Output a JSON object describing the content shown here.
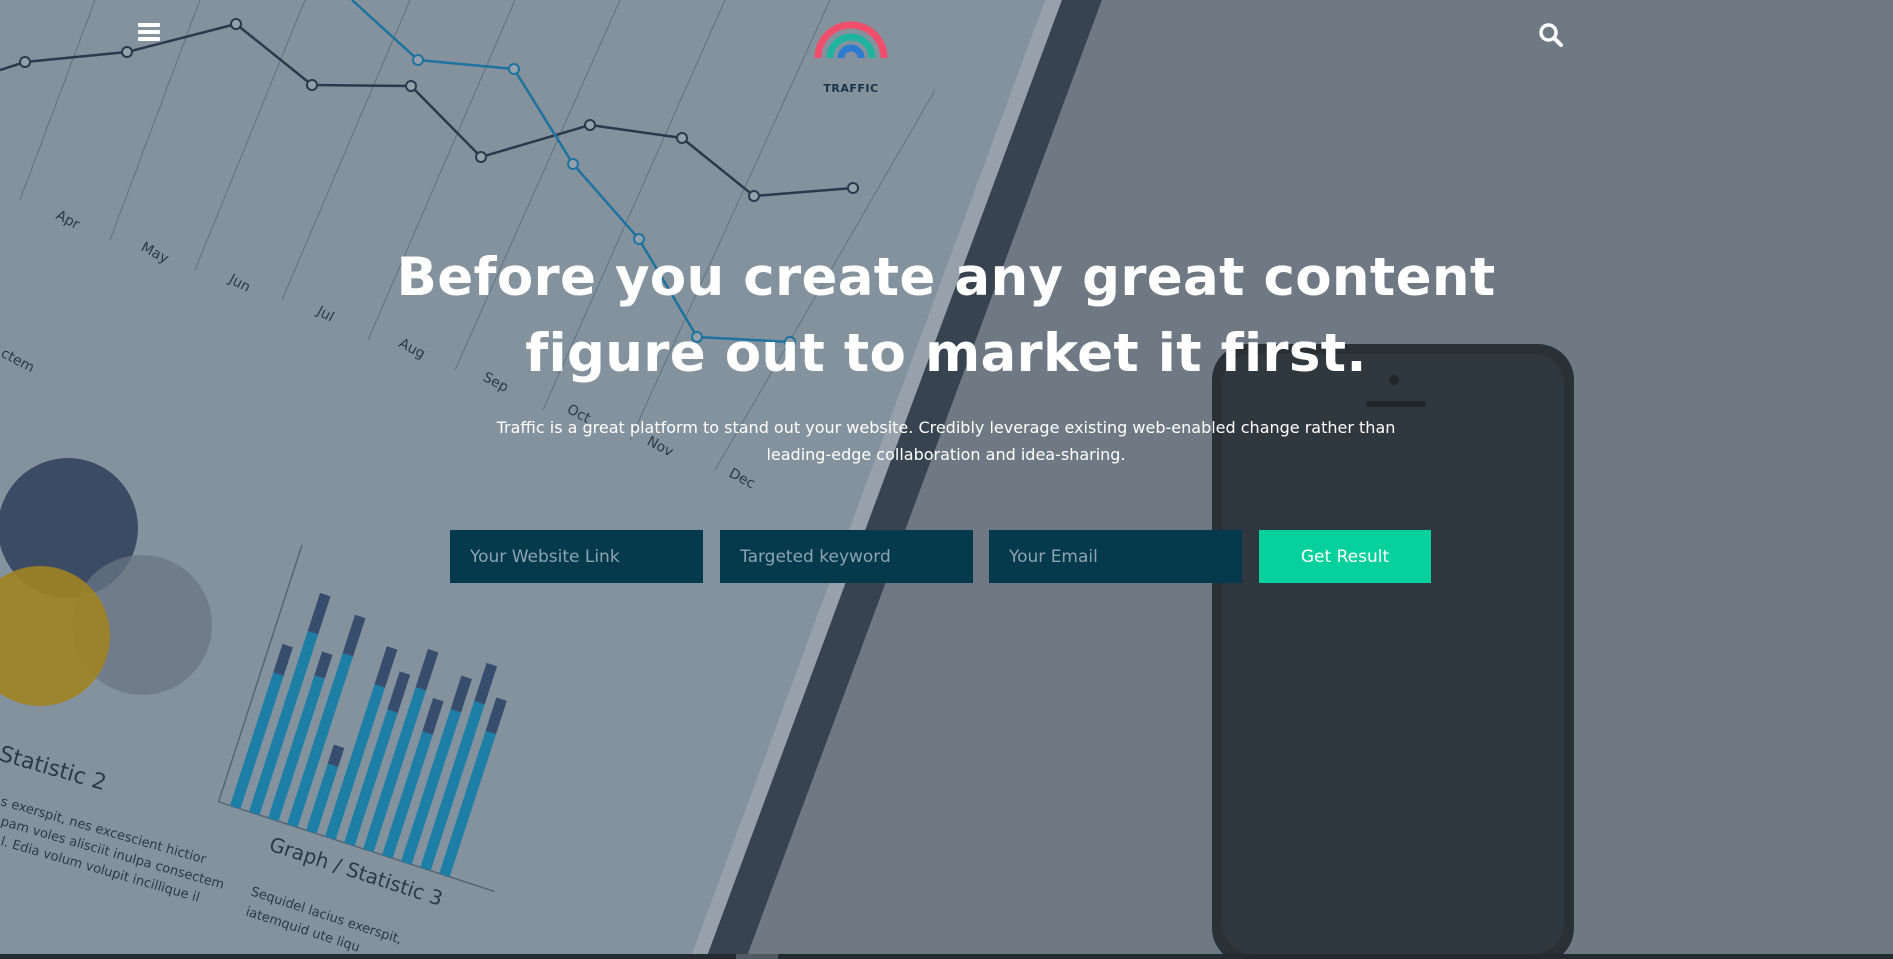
{
  "header": {
    "menu_icon": "hamburger-menu-icon",
    "logo_text": "TRAFFIC",
    "logo_colors": [
      "#ef4f6b",
      "#20b39f",
      "#2d7bd0"
    ],
    "search_icon": "search-icon"
  },
  "hero": {
    "headline_line1": "Before you create any great content",
    "headline_line2": "figure out to market it first.",
    "subtext_line1": "Traffic is a great platform to stand out your website. Credibly leverage existing web-enabled change rather than",
    "subtext_line2": "leading-edge collaboration and idea-sharing."
  },
  "form": {
    "website_placeholder": "Your Website Link",
    "keyword_placeholder": "Targeted keyword",
    "email_placeholder": "Your Email",
    "submit_label": "Get Result",
    "field_color": "#053a4d",
    "button_color": "#06d19c"
  }
}
